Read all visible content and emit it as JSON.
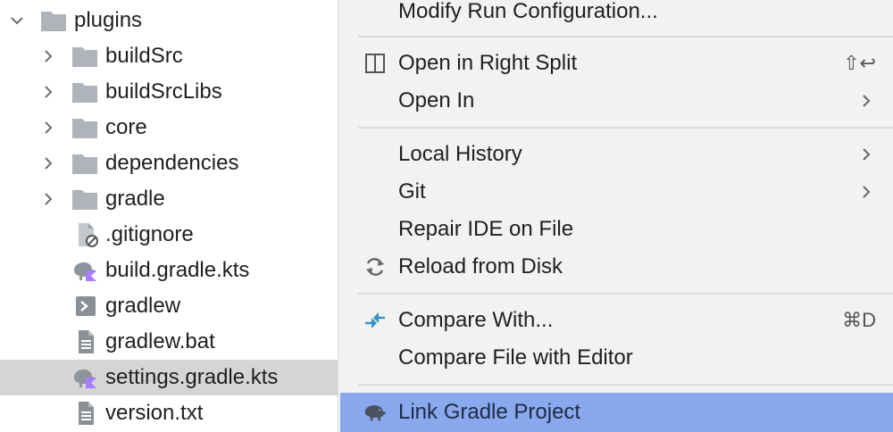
{
  "tree": {
    "root": {
      "label": "plugins"
    },
    "items": [
      {
        "label": "buildSrc",
        "kind": "folder",
        "expandable": true
      },
      {
        "label": "buildSrcLibs",
        "kind": "folder",
        "expandable": true
      },
      {
        "label": "core",
        "kind": "folder",
        "expandable": true
      },
      {
        "label": "dependencies",
        "kind": "folder",
        "expandable": true
      },
      {
        "label": "gradle",
        "kind": "folder",
        "expandable": true
      },
      {
        "label": ".gitignore",
        "kind": "gitignore-file"
      },
      {
        "label": "build.gradle.kts",
        "kind": "gradle-kts-file"
      },
      {
        "label": "gradlew",
        "kind": "script-file"
      },
      {
        "label": "gradlew.bat",
        "kind": "text-file"
      },
      {
        "label": "settings.gradle.kts",
        "kind": "gradle-kts-file",
        "selected": true
      },
      {
        "label": "version.txt",
        "kind": "text-file"
      }
    ]
  },
  "menu": {
    "items": [
      {
        "label": "Modify Run Configuration..."
      },
      {
        "label": "Open in Right Split",
        "icon": "split-view-icon",
        "shortcut": "⇧↩"
      },
      {
        "label": "Open In",
        "submenu": true
      },
      {
        "label": "Local History",
        "submenu": true
      },
      {
        "label": "Git",
        "submenu": true
      },
      {
        "label": "Repair IDE on File"
      },
      {
        "label": "Reload from Disk",
        "icon": "reload-icon"
      },
      {
        "label": "Compare With...",
        "icon": "compare-arrows-icon",
        "shortcut": "⌘D"
      },
      {
        "label": "Compare File with Editor"
      },
      {
        "label": "Link Gradle Project",
        "icon": "gradle-elephant-icon",
        "highlighted": true
      }
    ],
    "highlight_color": "#8aa8ee"
  },
  "colors": {
    "folder_icon": "#aeb4ba",
    "kotlin_badge": "#a97bff",
    "compare_icon": "#3592c4",
    "menu_background": "#f2f2f2",
    "selected_row": "#d5d5d5"
  }
}
